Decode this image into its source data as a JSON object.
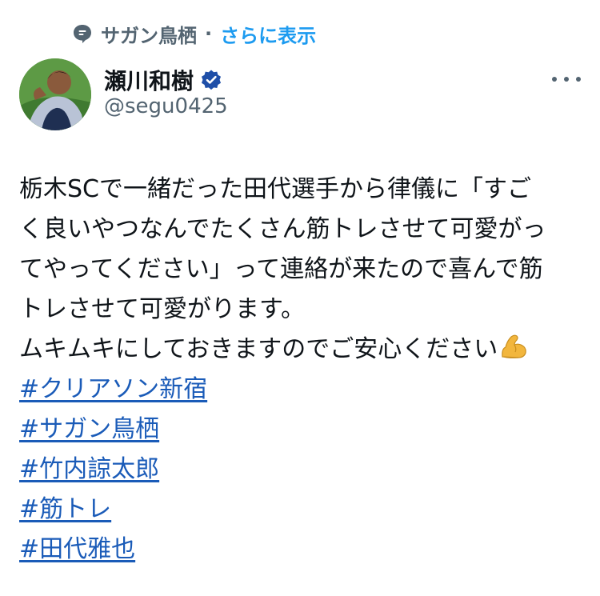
{
  "context": {
    "community_name": "サガン鳥栖",
    "separator": "·",
    "show_more": "さらに表示",
    "icon": "community-bubble-icon"
  },
  "author": {
    "display_name": "瀬川和樹",
    "handle": "@segu0425",
    "verified_icon": "verified-badge-icon",
    "avatar_icon": "profile-photo"
  },
  "post": {
    "lines": [
      "栃木SCで一緒だった田代選手から律儀に「すご",
      "く良いやつなんでたくさん筋トレさせて可愛がっ",
      "てやってください」って連絡が来たので喜んで筋",
      "トレさせて可愛がります。",
      "ムキムキにしておきますのでご安心ください"
    ],
    "emoji": "flexed-biceps-icon",
    "hashtags": [
      "#クリアソン新宿",
      "#サガン鳥栖",
      "#竹内諒太郎",
      "#筋トレ",
      "#田代雅也"
    ]
  },
  "colors": {
    "text": "#0f1419",
    "secondary": "#536471",
    "link": "#1d9bf0",
    "hashtag": "#1a5bb8"
  }
}
